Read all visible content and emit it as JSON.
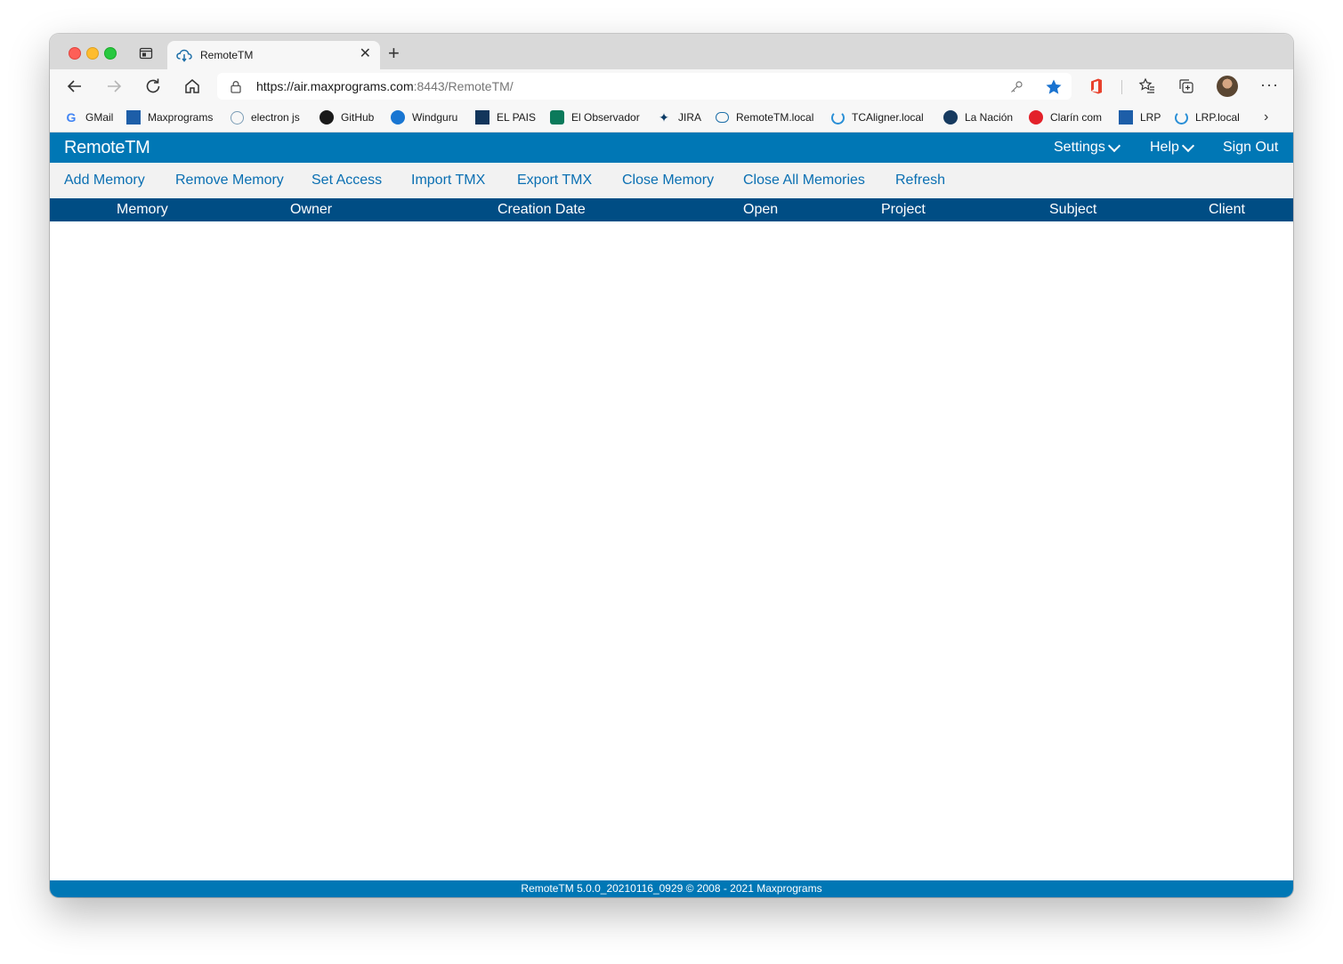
{
  "browser": {
    "tab_title": "RemoteTM",
    "url_host": "https://air.maxprograms.com",
    "url_rest": ":8443/RemoteTM/"
  },
  "bookmarks": [
    {
      "label": "GMail",
      "icon": "google-icon"
    },
    {
      "label": "Maxprograms",
      "icon": "maxprograms-icon"
    },
    {
      "label": "electron js",
      "icon": "electron-icon"
    },
    {
      "label": "GitHub",
      "icon": "github-icon"
    },
    {
      "label": "Windguru",
      "icon": "windguru-icon"
    },
    {
      "label": "EL PAIS",
      "icon": "elpais-icon"
    },
    {
      "label": "El Observador",
      "icon": "elobservador-icon"
    },
    {
      "label": "JIRA",
      "icon": "jira-icon"
    },
    {
      "label": "RemoteTM.local",
      "icon": "remotetm-icon"
    },
    {
      "label": "TCAligner.local",
      "icon": "tcaligner-icon"
    },
    {
      "label": "La Nación",
      "icon": "lanacion-icon"
    },
    {
      "label": "Clarín com",
      "icon": "clarin-icon"
    },
    {
      "label": "LRP",
      "icon": "lrp-icon"
    },
    {
      "label": "LRP.local",
      "icon": "lrplocal-icon"
    }
  ],
  "app": {
    "brand": "RemoteTM",
    "menu": {
      "settings": "Settings",
      "help": "Help",
      "sign_out": "Sign Out"
    },
    "actions": [
      "Add Memory",
      "Remove Memory",
      "Set Access",
      "Import TMX",
      "Export TMX",
      "Close Memory",
      "Close All Memories",
      "Refresh"
    ],
    "columns": [
      "Memory",
      "Owner",
      "Creation Date",
      "Open",
      "Project",
      "Subject",
      "Client"
    ],
    "footer": "RemoteTM 5.0.0_20210116_0929 © 2008 - 2021 Maxprograms"
  },
  "colors": {
    "header_blue": "#0077b5",
    "table_header_blue": "#004d84",
    "link_blue": "#0a6fb2"
  }
}
